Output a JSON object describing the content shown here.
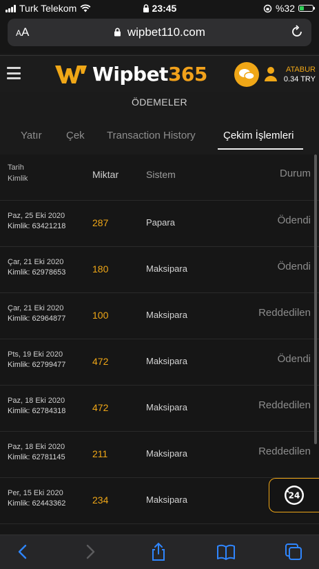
{
  "status_bar": {
    "carrier": "Turk Telekom",
    "time": "23:45",
    "battery": "%32",
    "battery_level": 0.32
  },
  "browser": {
    "aa_label": "AA",
    "url": "wipbet110.com"
  },
  "header": {
    "brand": "Wipbet",
    "brand_number": "365",
    "username": "ATABUR",
    "balance": "0.34 TRY"
  },
  "page_title": "ÖDEMELER",
  "tabs": [
    {
      "label": "Yatır"
    },
    {
      "label": "Çek"
    },
    {
      "label": "Transaction History"
    },
    {
      "label": "Çekim İşlemleri",
      "active": true
    }
  ],
  "table": {
    "headers": {
      "date": "Tarih",
      "id": "Kimlik",
      "amount": "Miktar",
      "system": "Sistem",
      "status": "Durum"
    },
    "rows": [
      {
        "date": "Paz, 25 Eki 2020",
        "id": "Kimlik: 63421218",
        "amount": "287",
        "system": "Papara",
        "status": "Ödendi"
      },
      {
        "date": "Çar, 21 Eki 2020",
        "id": "Kimlik: 62978653",
        "amount": "180",
        "system": "Maksipara",
        "status": "Ödendi"
      },
      {
        "date": "Çar, 21 Eki 2020",
        "id": "Kimlik: 62964877",
        "amount": "100",
        "system": "Maksipara",
        "status": "Reddedilen"
      },
      {
        "date": "Pts, 19 Eki 2020",
        "id": "Kimlik: 62799477",
        "amount": "472",
        "system": "Maksipara",
        "status": "Ödendi"
      },
      {
        "date": "Paz, 18 Eki 2020",
        "id": "Kimlik: 62784318",
        "amount": "472",
        "system": "Maksipara",
        "status": "Reddedilen"
      },
      {
        "date": "Paz, 18 Eki 2020",
        "id": "Kimlik: 62781145",
        "amount": "211",
        "system": "Maksipara",
        "status": "Reddedilen"
      },
      {
        "date": "Per, 15 Eki 2020",
        "id": "Kimlik: 62443362",
        "amount": "234",
        "system": "Maksipara",
        "status": ""
      }
    ]
  },
  "support_badge": "24",
  "colors": {
    "accent": "#f0a717",
    "background": "#161616"
  }
}
